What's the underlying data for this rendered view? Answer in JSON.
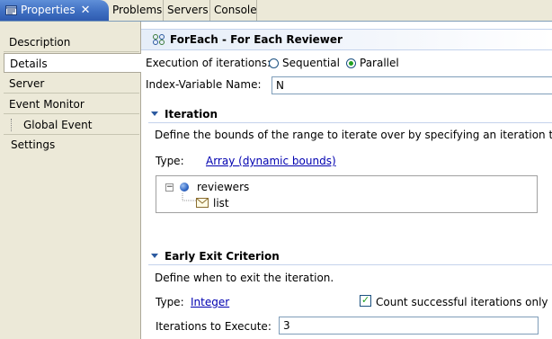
{
  "tabs": {
    "active": {
      "label": "Properties",
      "close": "✕",
      "icon": "properties-icon"
    },
    "others": [
      "Problems",
      "Servers",
      "Console"
    ]
  },
  "nav": {
    "items": [
      "Description",
      "Details",
      "Server",
      "Event Monitor"
    ],
    "sub_items": [
      "Global Event Settings"
    ],
    "selected": "Details"
  },
  "header": {
    "icon": "foreach-icon",
    "title": "ForEach - For Each Reviewer"
  },
  "execution": {
    "label": "Execution of iterations:",
    "options": [
      "Sequential",
      "Parallel"
    ],
    "selected": "Parallel"
  },
  "index_variable": {
    "label": "Index-Variable Name:",
    "value": "N"
  },
  "iteration": {
    "title": "Iteration",
    "description": "Define the bounds of the range to iterate over by specifying an iteration type.",
    "type_label": "Type:",
    "type_value": "Array (dynamic bounds)",
    "tree": {
      "root": "reviewers",
      "child": "list",
      "expander": "⊟"
    }
  },
  "early_exit": {
    "title": "Early Exit Criterion",
    "description": "Define when to exit the iteration.",
    "type_label": "Type:",
    "type_value": "Integer",
    "checkbox_label": "Count successful iterations only",
    "checkbox_checked": true,
    "iterations_label": "Iterations to Execute:",
    "iterations_value": "3"
  },
  "colors": {
    "tab_active": "#3f6fc2",
    "link": "#0000b0",
    "section_title": "#2c5aa0",
    "radio_dot": "#21a121"
  }
}
